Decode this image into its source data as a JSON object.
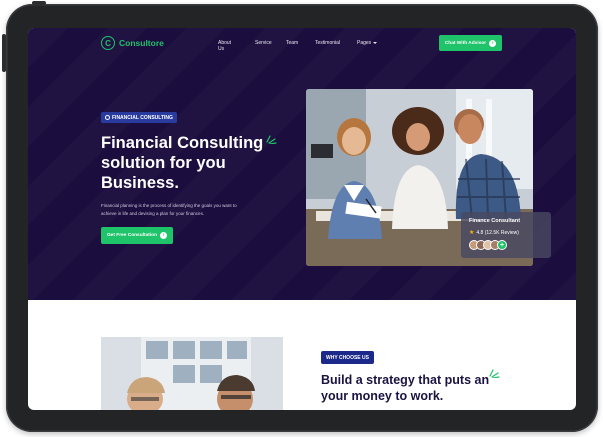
{
  "nav": {
    "logo_letter": "C",
    "logo_text": "Consultore",
    "items": [
      "About Us",
      "Service",
      "Team",
      "Testimonial",
      "Pages"
    ],
    "cta": "Chat With Advisor"
  },
  "hero": {
    "badge": "FINANCIAL CONSULTING",
    "title_lines": [
      "Financial Consulting",
      "solution for you",
      "Business."
    ],
    "description": "Financial planning is the process of identifying the goals you want to achieve in life and devising a plan for your finances.",
    "cta": "Get Free Consultation",
    "card": {
      "title": "Finance Consultant",
      "rating": "4.8 (12.5K Review)"
    }
  },
  "why": {
    "badge": "WHY CHOOSE US",
    "title_lines": [
      "Build a strategy that puts an",
      "your money to work."
    ]
  },
  "colors": {
    "hero_bg": "#1b0d3d",
    "accent_green": "#1ec36a",
    "badge_blue": "#2a3ba0",
    "dark_text": "#1b1341"
  },
  "icons": {
    "logo": "logo-c-circle-icon",
    "arrow": "circle-arrow-right-icon",
    "star": "star-icon",
    "plus": "plus-icon",
    "caret": "chevron-down-icon",
    "sparkle": "sparkle-lines-icon"
  }
}
